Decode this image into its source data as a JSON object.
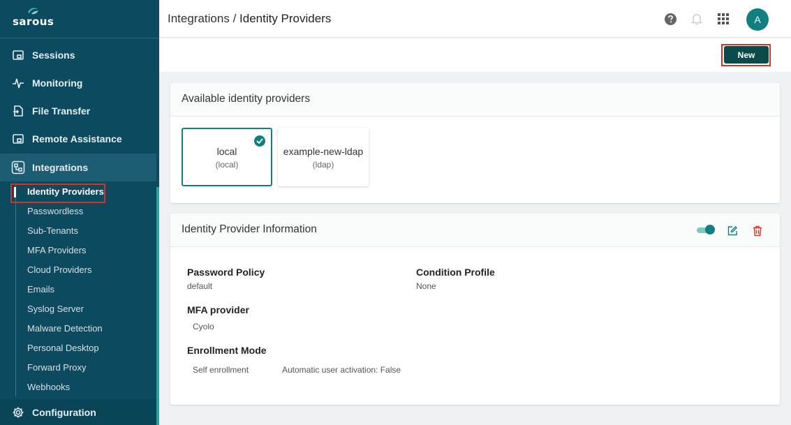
{
  "app": {
    "logo_text": "sarous"
  },
  "sidebar": {
    "items": [
      {
        "label": "Sessions",
        "icon": "sessions-icon"
      },
      {
        "label": "Monitoring",
        "icon": "activity-icon"
      },
      {
        "label": "File Transfer",
        "icon": "file-transfer-icon"
      },
      {
        "label": "Remote Assistance",
        "icon": "remote-assistance-icon"
      },
      {
        "label": "Integrations",
        "icon": "integrations-icon"
      }
    ],
    "sub_items": [
      {
        "label": "Identity Providers"
      },
      {
        "label": "Passwordless"
      },
      {
        "label": "Sub-Tenants"
      },
      {
        "label": "MFA Providers"
      },
      {
        "label": "Cloud Providers"
      },
      {
        "label": "Emails"
      },
      {
        "label": "Syslog Server"
      },
      {
        "label": "Malware Detection"
      },
      {
        "label": "Personal Desktop"
      },
      {
        "label": "Forward Proxy"
      },
      {
        "label": "Webhooks"
      }
    ],
    "config": {
      "label": "Configuration",
      "icon": "gear-icon"
    }
  },
  "header": {
    "breadcrumb_parent": "Integrations",
    "breadcrumb_sep": " / ",
    "breadcrumb_current": "Identity Providers",
    "avatar_initial": "A"
  },
  "actions": {
    "new_label": "New"
  },
  "available": {
    "title": "Available identity providers",
    "providers": [
      {
        "name": "local",
        "type": "(local)",
        "selected": true
      },
      {
        "name": "example-new-ldap",
        "type": "(ldap)",
        "selected": false
      }
    ]
  },
  "info": {
    "title": "Identity Provider Information",
    "enabled": true,
    "password_policy_label": "Password Policy",
    "password_policy_value": "default",
    "condition_profile_label": "Condition Profile",
    "condition_profile_value": "None",
    "mfa_label": "MFA provider",
    "mfa_value": "Cyolo",
    "enrollment_label": "Enrollment Mode",
    "enrollment_value": "Self enrollment",
    "activation_value": "Automatic user activation: False"
  },
  "colors": {
    "sidebar_bg": "#0b4a5f",
    "accent": "#127f7f",
    "primary_button": "#0b4a4a",
    "danger": "#d93025"
  }
}
